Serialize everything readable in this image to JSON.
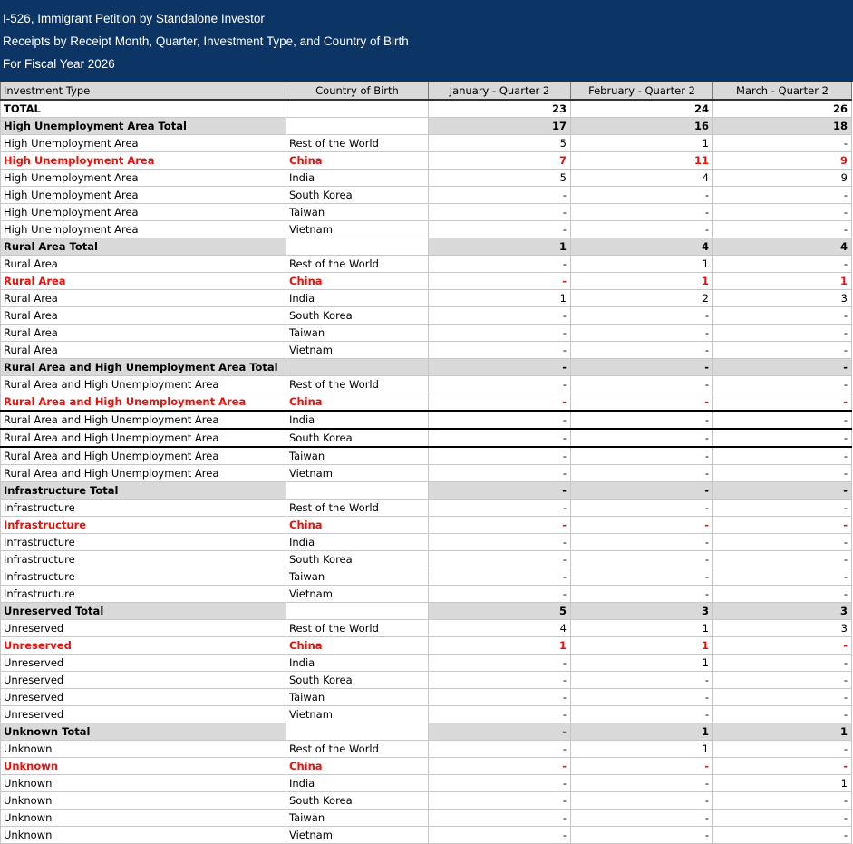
{
  "header": {
    "line1": "I-526, Immigrant Petition by Standalone Investor",
    "line2": "Receipts by Receipt Month, Quarter, Investment Type, and Country of Birth",
    "line3": "For Fiscal Year 2026"
  },
  "columns": [
    "Investment Type",
    "Country of Birth",
    "January - Quarter 2",
    "February - Quarter 2",
    "March - Quarter 2"
  ],
  "colors": {
    "header_bg": "#0c3566",
    "group_bg": "#d9d9d9",
    "china_text": "#e8120c"
  },
  "rows": [
    {
      "type": "total",
      "label": "TOTAL",
      "country": "",
      "jan": "23",
      "feb": "24",
      "mar": "26"
    },
    {
      "type": "group",
      "label": "High Unemployment Area Total",
      "country": "",
      "jan": "17",
      "feb": "16",
      "mar": "18"
    },
    {
      "type": "row",
      "label": "High Unemployment Area",
      "country": "Rest of the World",
      "jan": "5",
      "feb": "1",
      "mar": "-"
    },
    {
      "type": "china",
      "label": "High Unemployment Area",
      "country": "China",
      "jan": "7",
      "feb": "11",
      "mar": "9"
    },
    {
      "type": "row",
      "label": "High Unemployment Area",
      "country": "India",
      "jan": "5",
      "feb": "4",
      "mar": "9"
    },
    {
      "type": "row",
      "label": "High Unemployment Area",
      "country": "South Korea",
      "jan": "-",
      "feb": "-",
      "mar": "-"
    },
    {
      "type": "row",
      "label": "High Unemployment Area",
      "country": "Taiwan",
      "jan": "-",
      "feb": "-",
      "mar": "-"
    },
    {
      "type": "row",
      "label": "High Unemployment Area",
      "country": "Vietnam",
      "jan": "-",
      "feb": "-",
      "mar": "-"
    },
    {
      "type": "group",
      "label": "Rural Area Total",
      "country": "",
      "jan": "1",
      "feb": "4",
      "mar": "4"
    },
    {
      "type": "row",
      "label": "Rural Area",
      "country": "Rest of the World",
      "jan": "-",
      "feb": "1",
      "mar": "-"
    },
    {
      "type": "china",
      "label": "Rural Area",
      "country": "China",
      "jan": "-",
      "feb": "1",
      "mar": "1"
    },
    {
      "type": "row",
      "label": "Rural Area",
      "country": "India",
      "jan": "1",
      "feb": "2",
      "mar": "3"
    },
    {
      "type": "row",
      "label": "Rural Area",
      "country": "South Korea",
      "jan": "-",
      "feb": "-",
      "mar": "-"
    },
    {
      "type": "row",
      "label": "Rural Area",
      "country": "Taiwan",
      "jan": "-",
      "feb": "-",
      "mar": "-"
    },
    {
      "type": "row",
      "label": "Rural Area",
      "country": "Vietnam",
      "jan": "-",
      "feb": "-",
      "mar": "-"
    },
    {
      "type": "group2",
      "label": "Rural Area and High Unemployment Area Total",
      "country": "",
      "jan": "-",
      "feb": "-",
      "mar": "-"
    },
    {
      "type": "row",
      "label": "Rural Area and High Unemployment Area",
      "country": "Rest of the World",
      "jan": "-",
      "feb": "-",
      "mar": "-"
    },
    {
      "type": "china",
      "label": "Rural Area and High Unemployment Area",
      "country": "China",
      "jan": "-",
      "feb": "-",
      "mar": "-"
    },
    {
      "type": "sep",
      "label": "Rural Area and High Unemployment Area",
      "country": "India",
      "jan": "-",
      "feb": "-",
      "mar": "-"
    },
    {
      "type": "sep",
      "label": "Rural Area and High Unemployment Area",
      "country": "South Korea",
      "jan": "-",
      "feb": "-",
      "mar": "-"
    },
    {
      "type": "sep",
      "label": "Rural Area and High Unemployment Area",
      "country": "Taiwan",
      "jan": "-",
      "feb": "-",
      "mar": "-"
    },
    {
      "type": "row",
      "label": "Rural Area and High Unemployment Area",
      "country": "Vietnam",
      "jan": "-",
      "feb": "-",
      "mar": "-"
    },
    {
      "type": "group",
      "label": "Infrastructure Total",
      "country": "",
      "jan": "-",
      "feb": "-",
      "mar": "-"
    },
    {
      "type": "row",
      "label": "Infrastructure",
      "country": "Rest of the World",
      "jan": "-",
      "feb": "-",
      "mar": "-"
    },
    {
      "type": "china",
      "label": "Infrastructure",
      "country": "China",
      "jan": "-",
      "feb": "-",
      "mar": "-"
    },
    {
      "type": "row",
      "label": "Infrastructure",
      "country": "India",
      "jan": "-",
      "feb": "-",
      "mar": "-"
    },
    {
      "type": "row",
      "label": "Infrastructure",
      "country": "South Korea",
      "jan": "-",
      "feb": "-",
      "mar": "-"
    },
    {
      "type": "row",
      "label": "Infrastructure",
      "country": "Taiwan",
      "jan": "-",
      "feb": "-",
      "mar": "-"
    },
    {
      "type": "row",
      "label": "Infrastructure",
      "country": "Vietnam",
      "jan": "-",
      "feb": "-",
      "mar": "-"
    },
    {
      "type": "group",
      "label": "Unreserved Total",
      "country": "",
      "jan": "5",
      "feb": "3",
      "mar": "3"
    },
    {
      "type": "row",
      "label": "Unreserved",
      "country": "Rest of the World",
      "jan": "4",
      "feb": "1",
      "mar": "3"
    },
    {
      "type": "china",
      "label": "Unreserved",
      "country": "China",
      "jan": "1",
      "feb": "1",
      "mar": "-"
    },
    {
      "type": "row",
      "label": "Unreserved",
      "country": "India",
      "jan": "-",
      "feb": "1",
      "mar": "-"
    },
    {
      "type": "row",
      "label": "Unreserved",
      "country": "South Korea",
      "jan": "-",
      "feb": "-",
      "mar": "-"
    },
    {
      "type": "row",
      "label": "Unreserved",
      "country": "Taiwan",
      "jan": "-",
      "feb": "-",
      "mar": "-"
    },
    {
      "type": "row",
      "label": "Unreserved",
      "country": "Vietnam",
      "jan": "-",
      "feb": "-",
      "mar": "-"
    },
    {
      "type": "group",
      "label": "Unknown Total",
      "country": "",
      "jan": "-",
      "feb": "1",
      "mar": "1"
    },
    {
      "type": "row",
      "label": "Unknown",
      "country": "Rest of the World",
      "jan": "-",
      "feb": "1",
      "mar": "-"
    },
    {
      "type": "china",
      "label": "Unknown",
      "country": "China",
      "jan": "-",
      "feb": "-",
      "mar": "-"
    },
    {
      "type": "row",
      "label": "Unknown",
      "country": "India",
      "jan": "-",
      "feb": "-",
      "mar": "1"
    },
    {
      "type": "row",
      "label": "Unknown",
      "country": "South Korea",
      "jan": "-",
      "feb": "-",
      "mar": "-"
    },
    {
      "type": "row",
      "label": "Unknown",
      "country": "Taiwan",
      "jan": "-",
      "feb": "-",
      "mar": "-"
    },
    {
      "type": "row",
      "label": "Unknown",
      "country": "Vietnam",
      "jan": "-",
      "feb": "-",
      "mar": "-"
    }
  ]
}
